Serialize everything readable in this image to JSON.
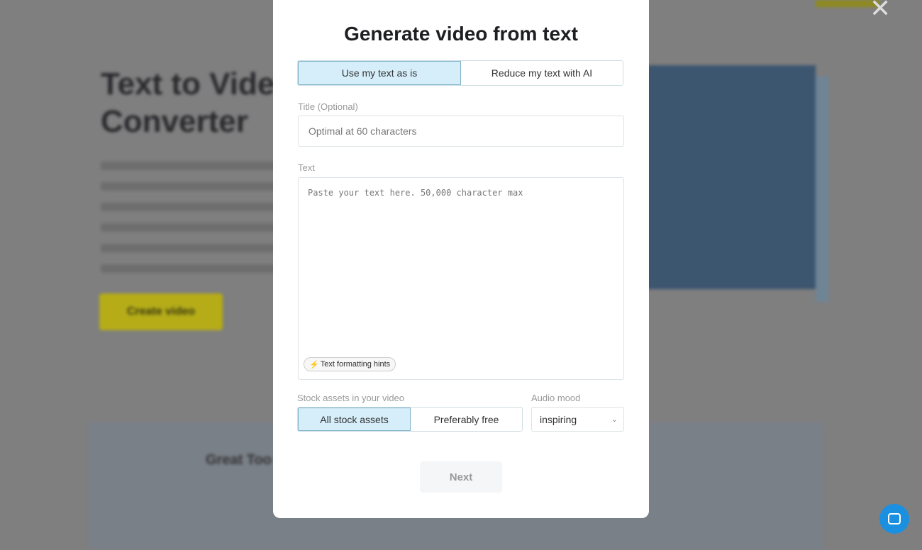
{
  "background": {
    "hero_title": "Text to Video Converter",
    "create_button": "Create video",
    "review_title": "Great Too"
  },
  "modal": {
    "title": "Generate video from text",
    "mode_tabs": [
      {
        "label": "Use my text as is",
        "active": true
      },
      {
        "label": "Reduce my text with AI",
        "active": false
      }
    ],
    "title_field": {
      "label": "Title (Optional)",
      "placeholder": "Optimal at 60 characters",
      "value": ""
    },
    "text_field": {
      "label": "Text",
      "placeholder": "Paste your text here. 50,000 character max",
      "value": ""
    },
    "hints_button": "Text formatting hints",
    "stock": {
      "label": "Stock assets in your video",
      "options": [
        {
          "label": "All stock assets",
          "active": true
        },
        {
          "label": "Preferably free",
          "active": false
        }
      ]
    },
    "audio": {
      "label": "Audio mood",
      "value": "inspiring"
    },
    "next_label": "Next"
  },
  "colors": {
    "active_tab": "#d5eef9",
    "accent": "#1b8fe0"
  }
}
